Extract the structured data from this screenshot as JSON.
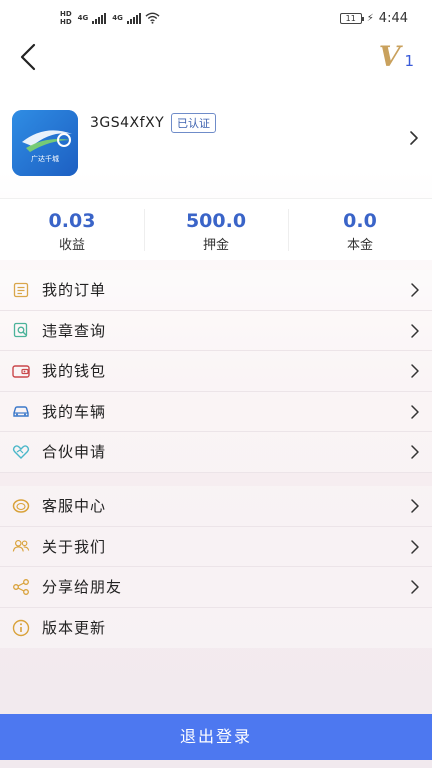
{
  "status_bar": {
    "hd1": "HD",
    "hd2": "HD",
    "net1": "4G",
    "net2": "4G",
    "battery": "11",
    "time": "4:44"
  },
  "nav": {
    "vip_letter": "V",
    "vip_level": "1"
  },
  "profile": {
    "logo_text": "广达千城",
    "username": "3GS4XfXY",
    "verified_badge": "已认证"
  },
  "stats": [
    {
      "value": "0.03",
      "label": "收益"
    },
    {
      "value": "500.0",
      "label": "押金"
    },
    {
      "value": "0.0",
      "label": "本金"
    }
  ],
  "menu_group1": [
    {
      "label": "我的订单",
      "icon": "order-icon"
    },
    {
      "label": "违章查询",
      "icon": "violation-search-icon"
    },
    {
      "label": "我的钱包",
      "icon": "wallet-icon"
    },
    {
      "label": "我的车辆",
      "icon": "car-icon"
    },
    {
      "label": "合伙申请",
      "icon": "partner-icon"
    }
  ],
  "menu_group2": [
    {
      "label": "客服中心",
      "icon": "customer-service-icon"
    },
    {
      "label": "关于我们",
      "icon": "about-us-icon"
    },
    {
      "label": "分享给朋友",
      "icon": "share-icon"
    },
    {
      "label": "版本更新",
      "icon": "info-icon"
    }
  ],
  "logout_label": "退出登录",
  "colors": {
    "accent": "#4d78f0",
    "stat_blue": "#3a64c8",
    "vip_gold": "#c9a15d"
  }
}
